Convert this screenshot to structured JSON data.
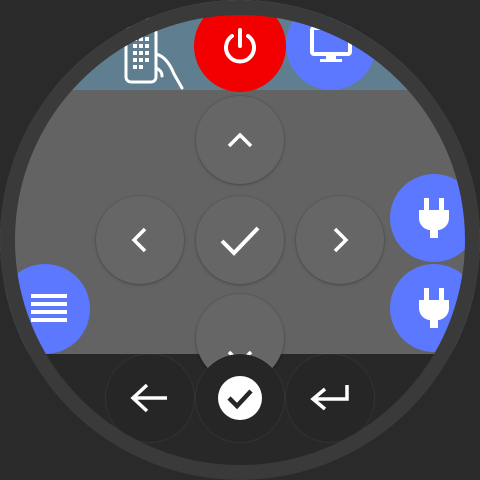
{
  "app": {
    "screen": "tv-remote-dpad"
  },
  "colors": {
    "accent": "#5b78ff",
    "power": "#f20000",
    "panel": "#636363",
    "header_band": "#5f7f91",
    "background": "#262626"
  },
  "icons": {
    "remote": "remote-hand-icon",
    "power": "power-icon",
    "tv": "tv-monitor-icon",
    "up": "chevron-up-icon",
    "down": "chevron-down-icon",
    "left": "chevron-left-icon",
    "right": "chevron-right-icon",
    "ok": "check-icon",
    "menu": "menu-icon",
    "plug": "plug-icon",
    "back": "arrow-left-icon",
    "confirm": "check-circle-icon",
    "enter": "enter-return-icon"
  }
}
